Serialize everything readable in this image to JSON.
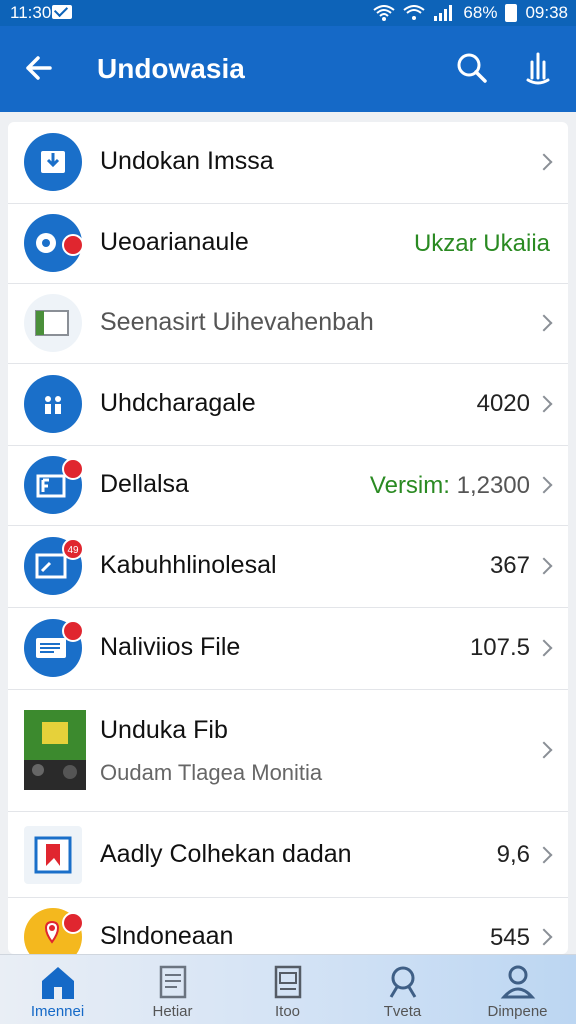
{
  "status_bar": {
    "time": "11:30",
    "battery": "68%",
    "clock_right": "09:38"
  },
  "app_bar": {
    "title": "Undowasia"
  },
  "rows": [
    {
      "label": "Undokan Imssa",
      "value": ""
    },
    {
      "label": "Ueoarianaule",
      "value": "Ukzar Ukaiia"
    },
    {
      "label": "Seenasirt Uihevahenbah",
      "value": ""
    },
    {
      "label": "Uhdcharagale",
      "value": "4020"
    },
    {
      "label": "Dellalsa",
      "value_green": "Versim:",
      "value_grey": "1,2300"
    },
    {
      "label": "Kabuhhlinolesal",
      "value": "367",
      "badge": "49"
    },
    {
      "label": "Naliviios File",
      "value": "107.5"
    },
    {
      "label": "Unduka Fib",
      "sub": "Oudam Tlagea Monitia"
    },
    {
      "label": "Aadly Colhekan dadan",
      "value": "9,6"
    },
    {
      "label": "Slndoneaan",
      "value": "545"
    }
  ],
  "bottom_nav": [
    {
      "label": "Imennei",
      "icon": "home-icon"
    },
    {
      "label": "Hetiar",
      "icon": "calendar-icon"
    },
    {
      "label": "Itoo",
      "icon": "document-icon"
    },
    {
      "label": "Tveta",
      "icon": "search-icon"
    },
    {
      "label": "Dimpene",
      "icon": "profile-icon"
    }
  ],
  "colors": {
    "primary": "#1569c7",
    "badge": "#e0262f",
    "accent_green": "#2a8a22"
  }
}
